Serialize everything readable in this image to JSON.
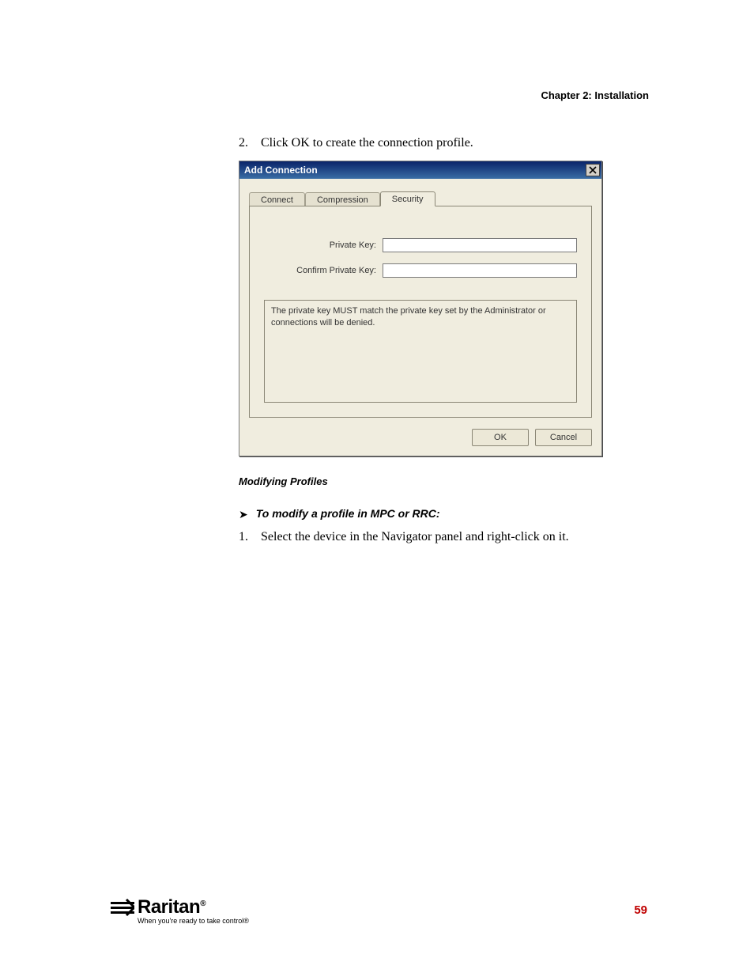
{
  "header": {
    "chapter": "Chapter 2: Installation"
  },
  "step2": {
    "num": "2.",
    "text": "Click OK to create the connection profile."
  },
  "dialog": {
    "title": "Add Connection",
    "tabs": {
      "connect": "Connect",
      "compression": "Compression",
      "security": "Security"
    },
    "labels": {
      "private_key": "Private Key:",
      "confirm_private_key": "Confirm Private Key:"
    },
    "values": {
      "private_key": "",
      "confirm_private_key": ""
    },
    "hint": "The private key MUST match the private key set by the Administrator or connections will be denied.",
    "buttons": {
      "ok": "OK",
      "cancel": "Cancel"
    }
  },
  "subheading": "Modifying Profiles",
  "action": {
    "arrow": "➤",
    "text": "To modify a profile in MPC or RRC:"
  },
  "step1": {
    "num": "1.",
    "text": "Select the device in the Navigator panel and right-click on it."
  },
  "footer": {
    "brand": "Raritan",
    "reg": "®",
    "tagline": "When you're ready to take control®",
    "page": "59"
  }
}
